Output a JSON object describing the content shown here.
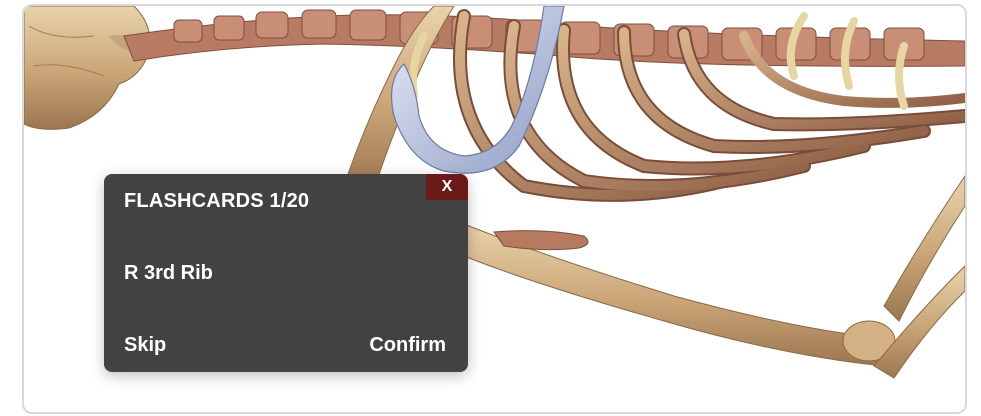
{
  "flashcard": {
    "title": "FLASHCARDS 1/20",
    "close_label": "X",
    "answer": "R 3rd Rib",
    "skip_label": "Skip",
    "confirm_label": "Confirm"
  },
  "colors": {
    "card_background": "#424242",
    "close_background": "#6b1a17",
    "bone": "#d7b98c",
    "vertebra": "#b8735f",
    "highlight_rib": "#b9c4de"
  }
}
